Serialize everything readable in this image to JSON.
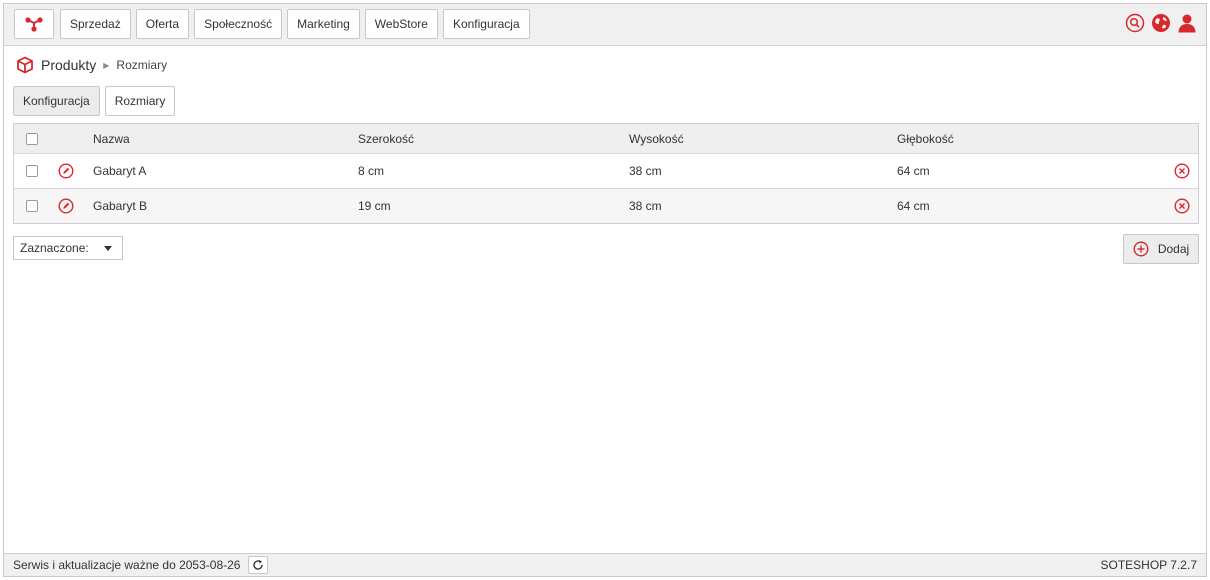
{
  "colors": {
    "accent": "#d9272e",
    "bar_bg": "#f0f0f0",
    "border": "#c8c8c8"
  },
  "topbar": {
    "logo_icon": "share-node-icon",
    "nav": [
      "Sprzedaż",
      "Oferta",
      "Społeczność",
      "Marketing",
      "WebStore",
      "Konfiguracja"
    ],
    "icons": [
      "search-icon",
      "globe-icon",
      "user-icon"
    ]
  },
  "breadcrumb": {
    "main": "Produkty",
    "sub": "Rozmiary",
    "icon": "cube-icon"
  },
  "tabs": {
    "config_label": "Konfiguracja",
    "sizes_label": "Rozmiary"
  },
  "table": {
    "headers": {
      "name": "Nazwa",
      "width": "Szerokość",
      "height": "Wysokość",
      "depth": "Głębokość"
    },
    "rows": [
      {
        "name": "Gabaryt A",
        "width": "8 cm",
        "height": "38 cm",
        "depth": "64 cm"
      },
      {
        "name": "Gabaryt B",
        "width": "19 cm",
        "height": "38 cm",
        "depth": "64 cm"
      }
    ]
  },
  "actions": {
    "selected_label": "Zaznaczone:",
    "add_label": "Dodaj"
  },
  "footer": {
    "service_text": "Serwis i aktualizacje ważne do 2053-08-26",
    "version": "SOTESHOP 7.2.7"
  }
}
